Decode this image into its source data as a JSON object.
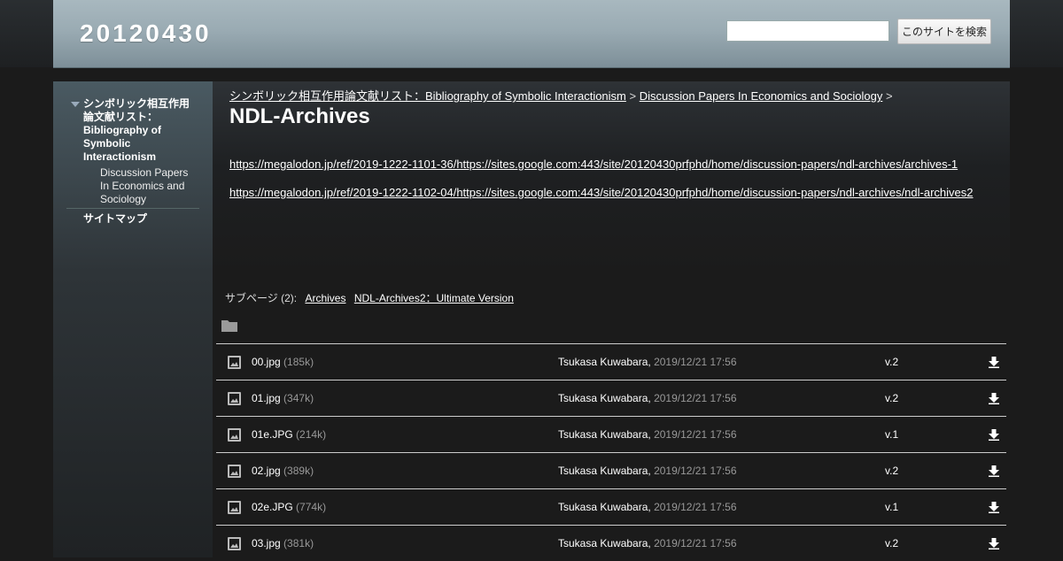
{
  "header": {
    "site_title": "20120430",
    "search_placeholder": "",
    "search_button_label": "このサイトを検索"
  },
  "sidebar": {
    "items": [
      {
        "label": "シンボリック相互作用論文献リスト：Bibliography of Symbolic Interactionism",
        "expanded": true
      },
      {
        "label": "Discussion Papers In Economics and Sociology"
      },
      {
        "label": "サイトマップ"
      }
    ]
  },
  "breadcrumb": {
    "items": [
      "シンボリック相互作用論文献リスト：Bibliography of Symbolic Interactionism",
      "Discussion Papers In Economics and Sociology"
    ],
    "separator": ">"
  },
  "page": {
    "title": "NDL-Archives",
    "links": [
      "https://megalodon.jp/ref/2019-1222-1101-36/https://sites.google.com:443/site/20120430prfphd/home/discussion-papers/ndl-archives/archives-1",
      "https://megalodon.jp/ref/2019-1222-1102-04/https://sites.google.com:443/site/20120430prfphd/home/discussion-papers/ndl-archives/ndl-archives2"
    ]
  },
  "subpages": {
    "label": "サブページ (2):",
    "items": [
      "Archives",
      "NDL-Archives2：Ultimate Version"
    ]
  },
  "attachments": [
    {
      "name": "00.jpg",
      "size": "(185k)",
      "author": "Tsukasa Kuwabara,",
      "date": "2019/12/21 17:56",
      "version": "v.2"
    },
    {
      "name": "01.jpg",
      "size": "(347k)",
      "author": "Tsukasa Kuwabara,",
      "date": "2019/12/21 17:56",
      "version": "v.2"
    },
    {
      "name": "01e.JPG",
      "size": "(214k)",
      "author": "Tsukasa Kuwabara,",
      "date": "2019/12/21 17:56",
      "version": "v.1"
    },
    {
      "name": "02.jpg",
      "size": "(389k)",
      "author": "Tsukasa Kuwabara,",
      "date": "2019/12/21 17:56",
      "version": "v.2"
    },
    {
      "name": "02e.JPG",
      "size": "(774k)",
      "author": "Tsukasa Kuwabara,",
      "date": "2019/12/21 17:56",
      "version": "v.1"
    },
    {
      "name": "03.jpg",
      "size": "(381k)",
      "author": "Tsukasa Kuwabara,",
      "date": "2019/12/21 17:56",
      "version": "v.2"
    }
  ],
  "icons": {
    "folder": "folder-icon",
    "file": "image-file-icon",
    "download": "download-icon"
  },
  "colors": {
    "header_bg": "#9aabb3",
    "page_bg": "#1b1b1b",
    "link": "#ffffff",
    "muted": "#999999"
  }
}
